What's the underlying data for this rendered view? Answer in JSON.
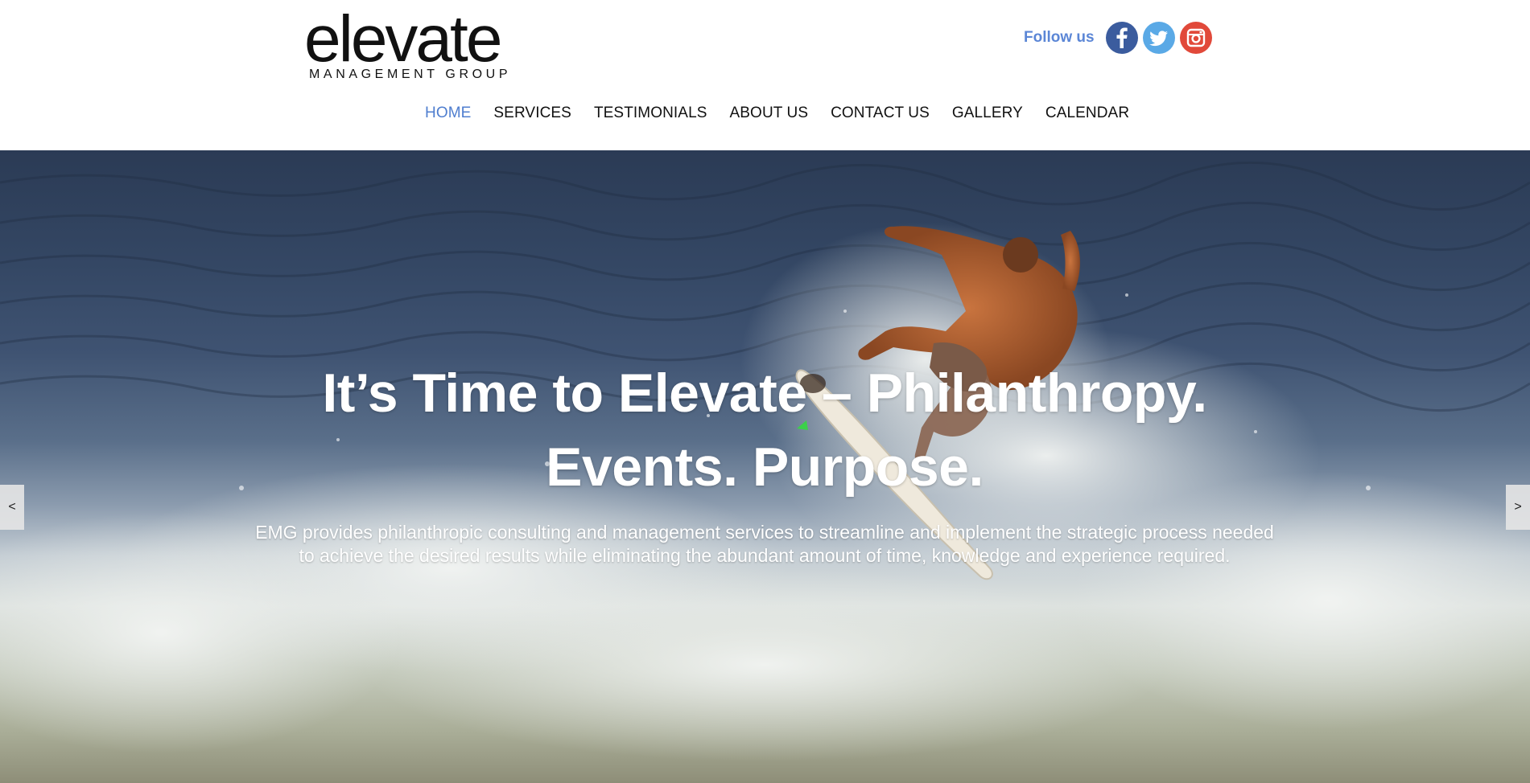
{
  "logo": {
    "word": "elevate",
    "subtitle": "MANAGEMENT GROUP"
  },
  "social": {
    "label": "Follow us",
    "icons": [
      "facebook-icon",
      "twitter-icon",
      "instagram-icon"
    ]
  },
  "nav": {
    "items": [
      {
        "label": "HOME",
        "active": true
      },
      {
        "label": "SERVICES",
        "active": false
      },
      {
        "label": "TESTIMONIALS",
        "active": false
      },
      {
        "label": "ABOUT US",
        "active": false
      },
      {
        "label": "CONTACT US",
        "active": false
      },
      {
        "label": "GALLERY",
        "active": false
      },
      {
        "label": "CALENDAR",
        "active": false
      }
    ]
  },
  "hero": {
    "title": "It’s Time to Elevate – Philanthropy. Events. Purpose.",
    "text": "EMG provides philanthropic consulting and management services to streamline and implement the strategic process needed to achieve the desired results while eliminating the abundant amount of time, knowledge and experience required.",
    "prev_label": "<",
    "next_label": ">"
  },
  "colors": {
    "accent": "#4f7ecf",
    "follow": "#5b86d6",
    "facebook": "#3b5c9e",
    "twitter": "#5aa9e6",
    "instagram": "#e1493a"
  }
}
